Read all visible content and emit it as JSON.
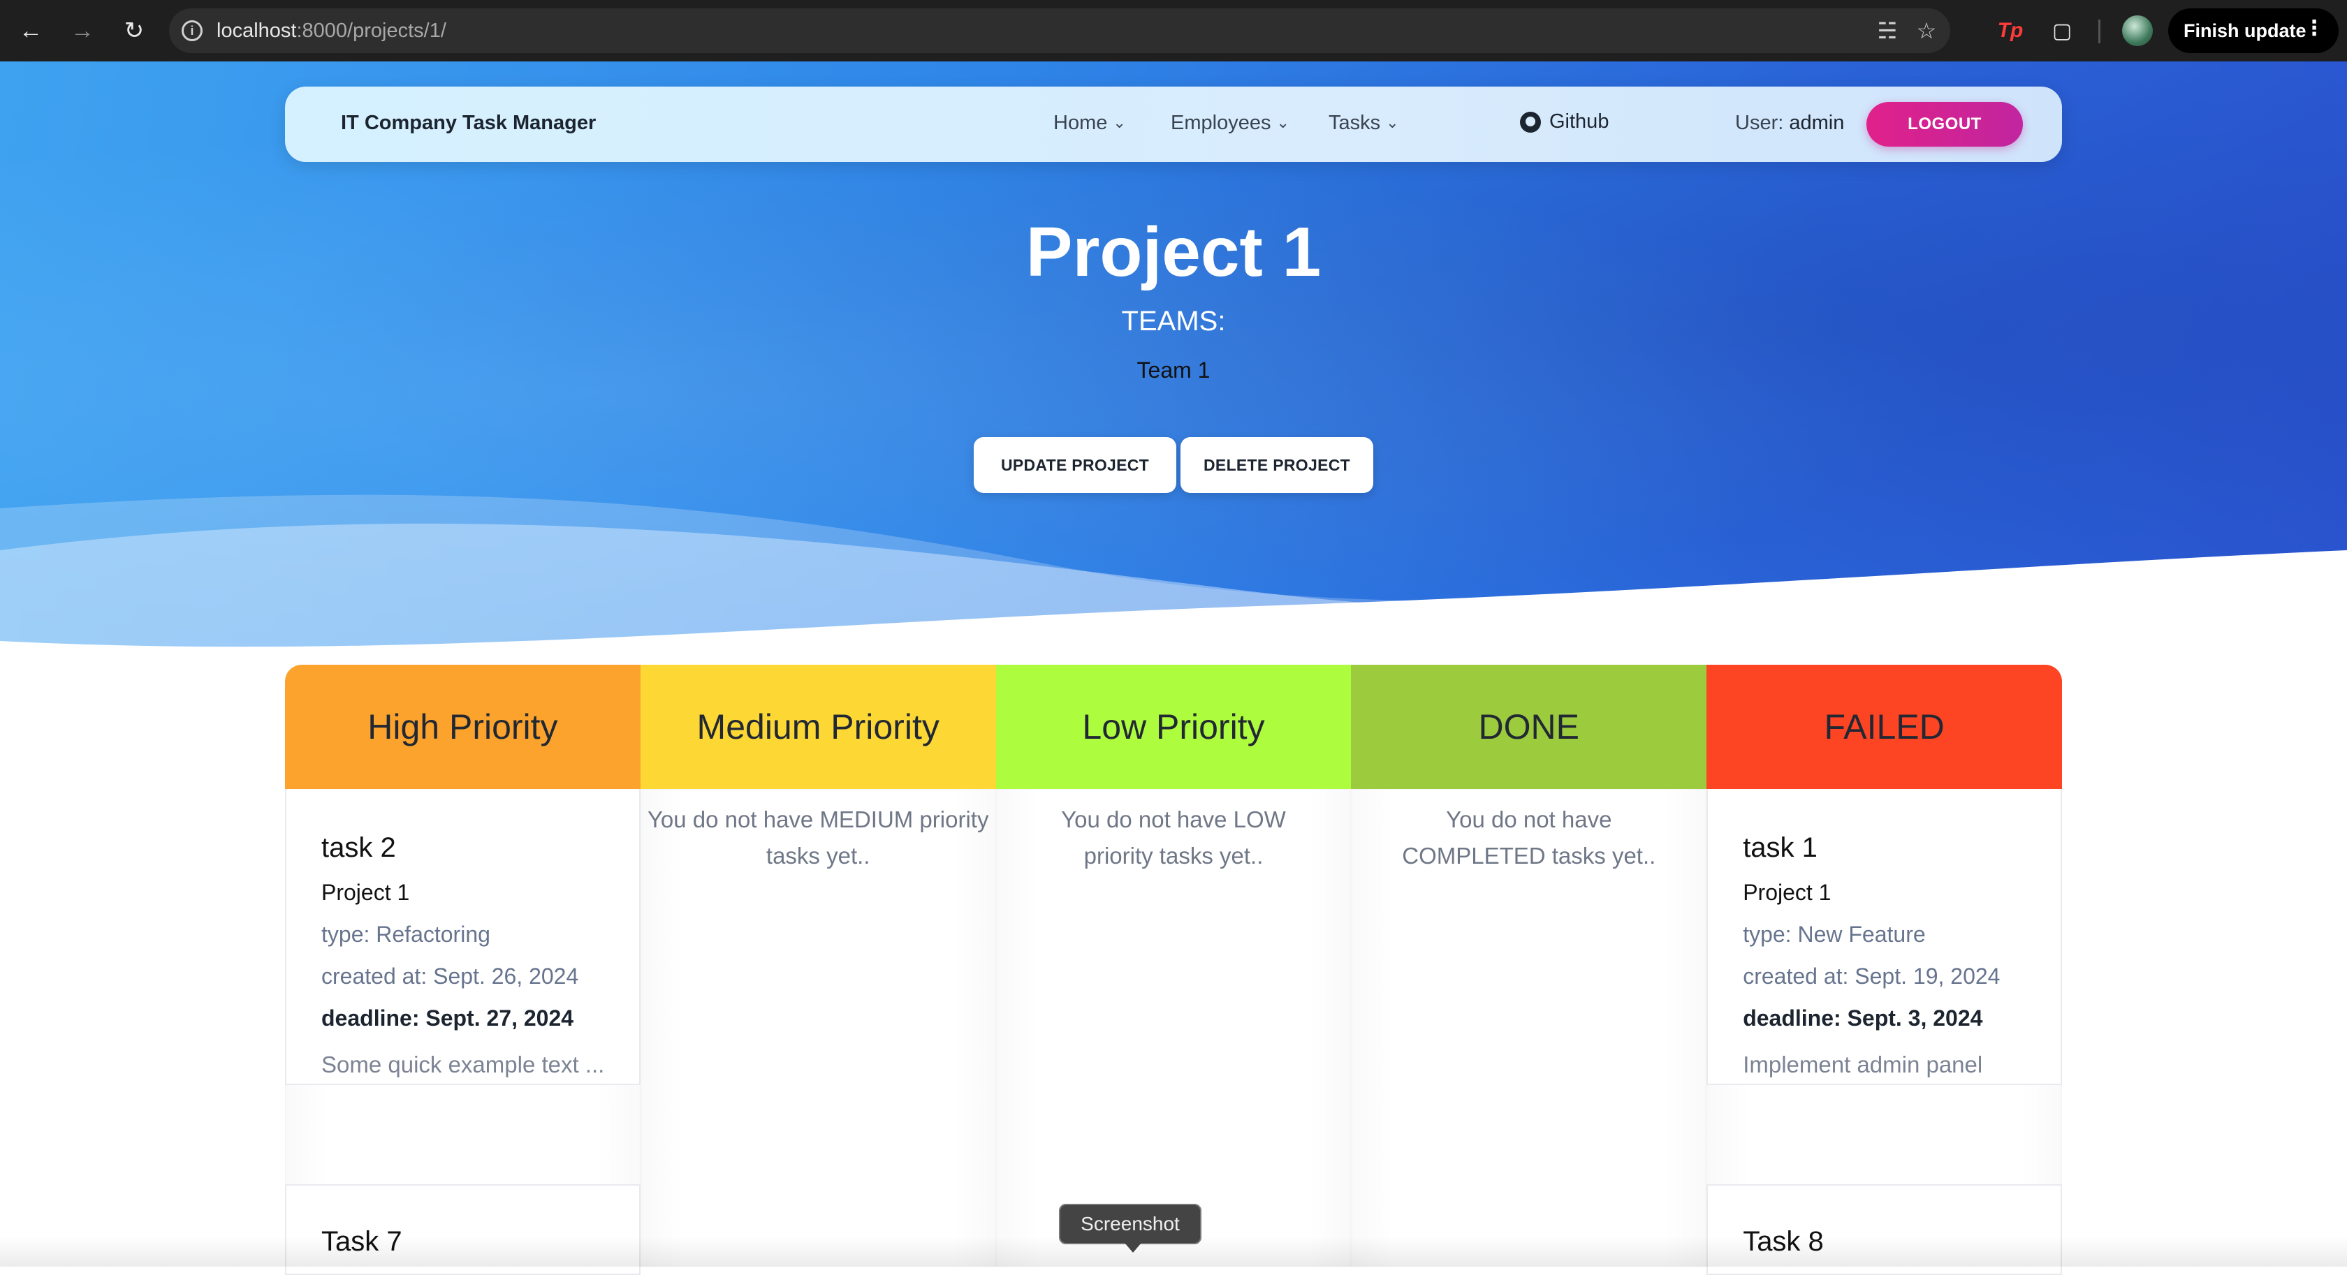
{
  "browser": {
    "url_host": "localhost",
    "url_path": ":8000/projects/1/",
    "finish_update_label": "Finish update",
    "extension_tp_label": "Tp"
  },
  "nav": {
    "brand": "IT Company Task Manager",
    "items": [
      {
        "label": "Home"
      },
      {
        "label": "Employees"
      },
      {
        "label": "Tasks"
      }
    ],
    "github_label": "Github",
    "user_prefix": "User: ",
    "user_name": "admin",
    "logout_label": "LOGOUT"
  },
  "project": {
    "title": "Project 1",
    "teams_heading": "TEAMS:",
    "teams": [
      "Team 1"
    ],
    "update_label": "UPDATE PROJECT",
    "delete_label": "DELETE PROJECT"
  },
  "columns": [
    {
      "title": "High Priority",
      "color": "#fba32c",
      "tasks": [
        {
          "name": "task 2",
          "project": "Project 1",
          "type": "type: Refactoring",
          "created": "created at: Sept. 26, 2024",
          "deadline": "deadline: Sept. 27, 2024",
          "description": "Some quick example text ..."
        },
        {
          "name": "Task 7"
        }
      ]
    },
    {
      "title": "Medium Priority",
      "color": "#fdd835",
      "empty_text": "You do not have MEDIUM priority tasks yet.."
    },
    {
      "title": "Low Priority",
      "color": "#adfc3d",
      "empty_text": "You do not have LOW priority tasks yet.."
    },
    {
      "title": "DONE",
      "color": "#9ccc3d",
      "empty_text": "You do not have COMPLETED tasks yet.."
    },
    {
      "title": "FAILED",
      "color": "#fd4423",
      "tasks": [
        {
          "name": "task 1",
          "project": "Project 1",
          "type": "type: New Feature",
          "created": "created at: Sept. 19, 2024",
          "deadline": "deadline: Sept. 3, 2024",
          "description": "Implement admin panel"
        },
        {
          "name": "Task 8"
        }
      ]
    }
  ],
  "tooltip": "Screenshot"
}
